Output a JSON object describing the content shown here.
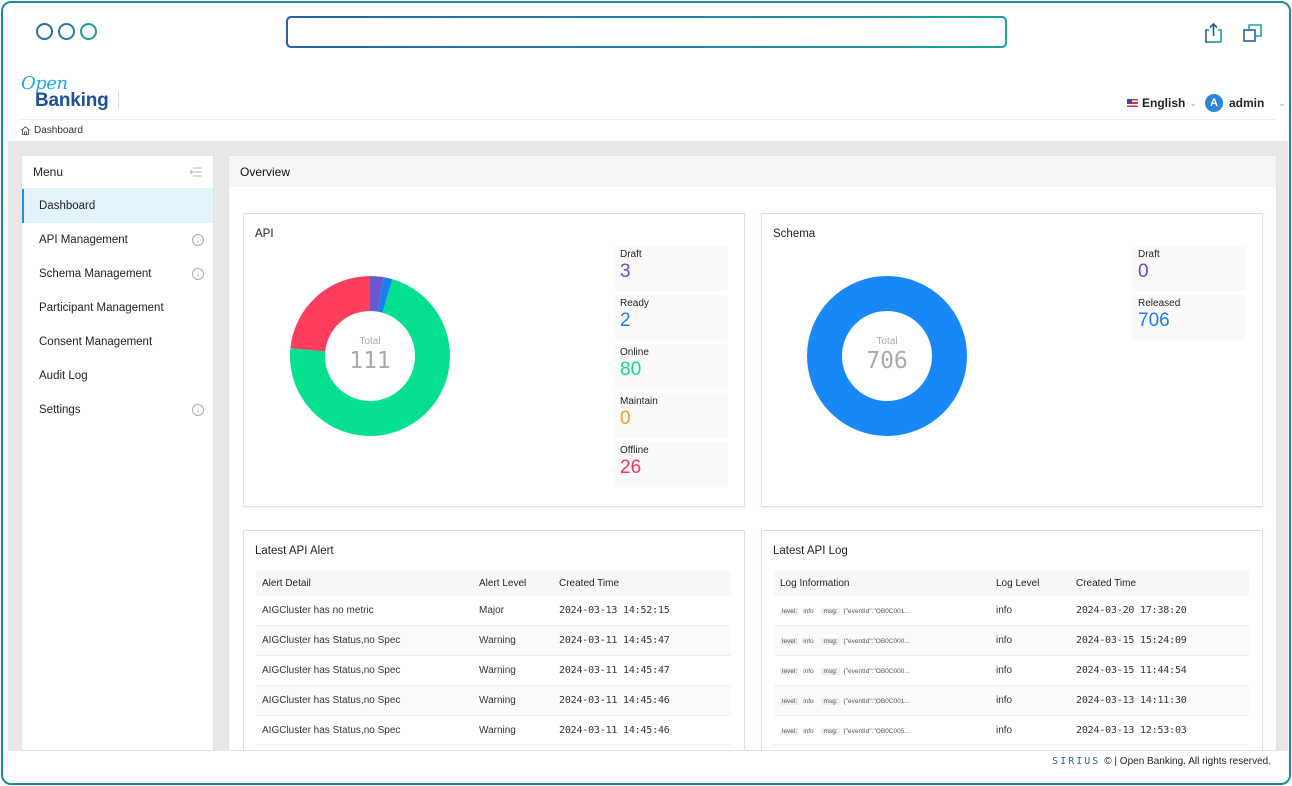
{
  "chrome": {
    "url": "",
    "share_icon": "share-icon",
    "windows_icon": "windows-icon"
  },
  "header": {
    "logo_top": "Open",
    "logo_bottom": "Banking",
    "language": "English",
    "user": "admin",
    "user_initial": "A"
  },
  "breadcrumb": {
    "items": [
      "Dashboard"
    ]
  },
  "sidebar": {
    "title": "Menu",
    "items": [
      {
        "label": "Dashboard",
        "active": true,
        "expandable": false
      },
      {
        "label": "API Management",
        "active": false,
        "expandable": true
      },
      {
        "label": "Schema Management",
        "active": false,
        "expandable": true
      },
      {
        "label": "Participant Management",
        "active": false,
        "expandable": false
      },
      {
        "label": "Consent Management",
        "active": false,
        "expandable": false
      },
      {
        "label": "Audit Log",
        "active": false,
        "expandable": false
      },
      {
        "label": "Settings",
        "active": false,
        "expandable": true
      }
    ]
  },
  "main": {
    "title": "Overview",
    "api_card": {
      "title": "API",
      "total_label": "Total",
      "total": "111",
      "stats": [
        {
          "label": "Draft",
          "value": "3",
          "color": "#6a45c8"
        },
        {
          "label": "Ready",
          "value": "2",
          "color": "#1a7ff0"
        },
        {
          "label": "Online",
          "value": "80",
          "color": "#19d68c"
        },
        {
          "label": "Maintain",
          "value": "0",
          "color": "#f0a020"
        },
        {
          "label": "Offline",
          "value": "26",
          "color": "#f0365a"
        }
      ]
    },
    "schema_card": {
      "title": "Schema",
      "total_label": "Total",
      "total": "706",
      "stats": [
        {
          "label": "Draft",
          "value": "0",
          "color": "#6a45c8"
        },
        {
          "label": "Released",
          "value": "706",
          "color": "#1a7ff0"
        }
      ]
    },
    "alert_card": {
      "title": "Latest API Alert",
      "columns": [
        "Alert Detail",
        "Alert Level",
        "Created Time"
      ],
      "rows": [
        [
          "AIGCluster has no metric",
          "Major",
          "2024-03-13 14:52:15"
        ],
        [
          "AIGCluster has Status,no Spec",
          "Warning",
          "2024-03-11 14:45:47"
        ],
        [
          "AIGCluster has Status,no Spec",
          "Warning",
          "2024-03-11 14:45:47"
        ],
        [
          "AIGCluster has Status,no Spec",
          "Warning",
          "2024-03-11 14:45:46"
        ],
        [
          "AIGCluster has Status,no Spec",
          "Warning",
          "2024-03-11 14:45:46"
        ]
      ]
    },
    "log_card": {
      "title": "Latest API Log",
      "columns": [
        "Log Information",
        "Log Level",
        "Created Time"
      ],
      "level_tag": "level:",
      "msg_tag": "msg:",
      "rows": [
        {
          "level": "info",
          "msg": "{\"eventId\":\"OB0C001...",
          "log_level": "info",
          "time": "2024-03-20 17:38:20"
        },
        {
          "level": "info",
          "msg": "{\"eventId\":\"OB0C000...",
          "log_level": "info",
          "time": "2024-03-15 15:24:09"
        },
        {
          "level": "info",
          "msg": "{\"eventId\":\"OB0C000...",
          "log_level": "info",
          "time": "2024-03-15 11:44:54"
        },
        {
          "level": "info",
          "msg": "{\"eventId\":\"OB0C001...",
          "log_level": "info",
          "time": "2024-03-13 14:11:30"
        },
        {
          "level": "info",
          "msg": "{\"eventId\":\"OB0C005...",
          "log_level": "info",
          "time": "2024-03-13 12:53:03"
        }
      ]
    }
  },
  "footer": {
    "brand": "SIRIUS",
    "text": "© | Open Banking. All rights reserved."
  },
  "chart_data": [
    {
      "type": "pie",
      "title": "API",
      "center_label": "Total",
      "center_value": 111,
      "categories": [
        "Draft",
        "Ready",
        "Online",
        "Maintain",
        "Offline"
      ],
      "values": [
        3,
        2,
        80,
        0,
        26
      ],
      "colors": [
        "#6a5ad0",
        "#1a7ff0",
        "#05e090",
        "#f0a020",
        "#ff3d5c"
      ]
    },
    {
      "type": "pie",
      "title": "Schema",
      "center_label": "Total",
      "center_value": 706,
      "categories": [
        "Draft",
        "Released"
      ],
      "values": [
        0,
        706
      ],
      "colors": [
        "#6a45c8",
        "#1888f8"
      ]
    }
  ]
}
